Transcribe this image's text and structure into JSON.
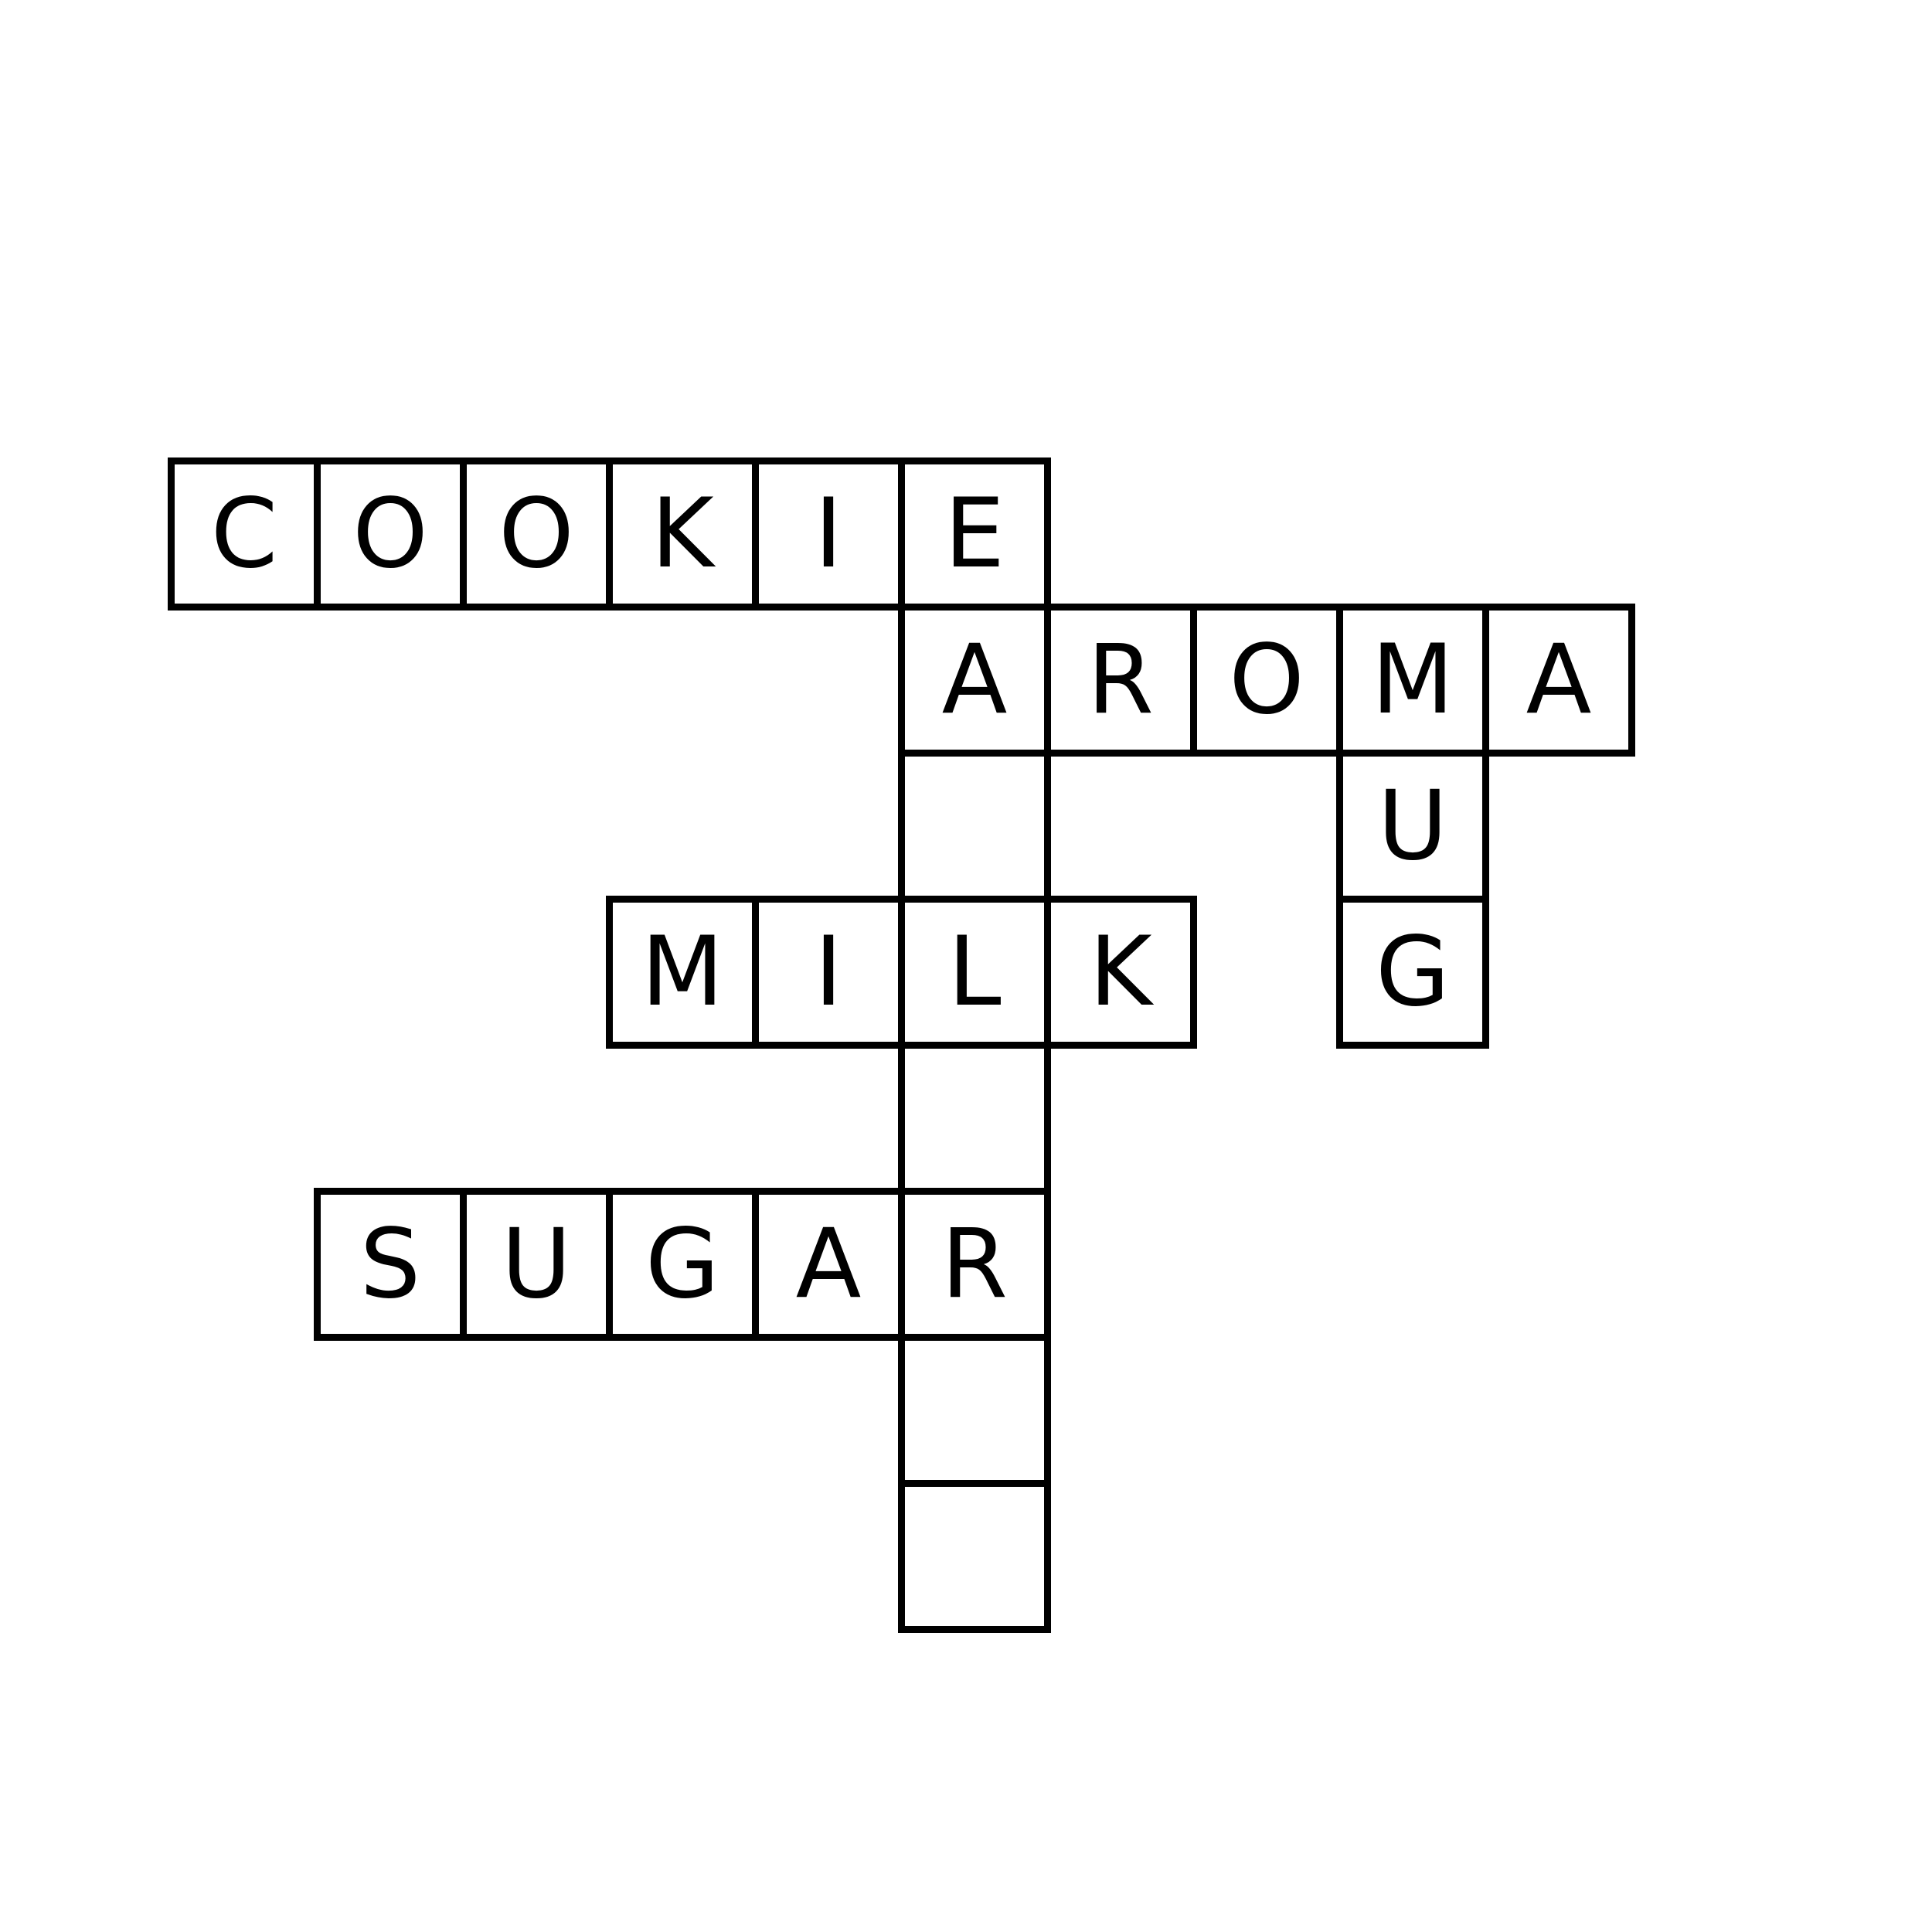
{
  "puzzle": {
    "colors": {
      "ink": "#000000",
      "background": "#ffffff"
    },
    "cells": [
      {
        "row": 0,
        "col": 0,
        "letter": "C"
      },
      {
        "row": 0,
        "col": 1,
        "letter": "O"
      },
      {
        "row": 0,
        "col": 2,
        "letter": "O"
      },
      {
        "row": 0,
        "col": 3,
        "letter": "K"
      },
      {
        "row": 0,
        "col": 4,
        "letter": "I"
      },
      {
        "row": 0,
        "col": 5,
        "letter": "E"
      },
      {
        "row": 1,
        "col": 5,
        "letter": "A"
      },
      {
        "row": 1,
        "col": 6,
        "letter": "R"
      },
      {
        "row": 1,
        "col": 7,
        "letter": "O"
      },
      {
        "row": 1,
        "col": 8,
        "letter": "M"
      },
      {
        "row": 1,
        "col": 9,
        "letter": "A"
      },
      {
        "row": 2,
        "col": 5,
        "letter": ""
      },
      {
        "row": 2,
        "col": 8,
        "letter": "U"
      },
      {
        "row": 3,
        "col": 3,
        "letter": "M"
      },
      {
        "row": 3,
        "col": 4,
        "letter": "I"
      },
      {
        "row": 3,
        "col": 5,
        "letter": "L"
      },
      {
        "row": 3,
        "col": 6,
        "letter": "K"
      },
      {
        "row": 3,
        "col": 8,
        "letter": "G"
      },
      {
        "row": 4,
        "col": 5,
        "letter": ""
      },
      {
        "row": 5,
        "col": 1,
        "letter": "S"
      },
      {
        "row": 5,
        "col": 2,
        "letter": "U"
      },
      {
        "row": 5,
        "col": 3,
        "letter": "G"
      },
      {
        "row": 5,
        "col": 4,
        "letter": "A"
      },
      {
        "row": 5,
        "col": 5,
        "letter": "R"
      },
      {
        "row": 6,
        "col": 5,
        "letter": ""
      },
      {
        "row": 7,
        "col": 5,
        "letter": ""
      }
    ]
  }
}
